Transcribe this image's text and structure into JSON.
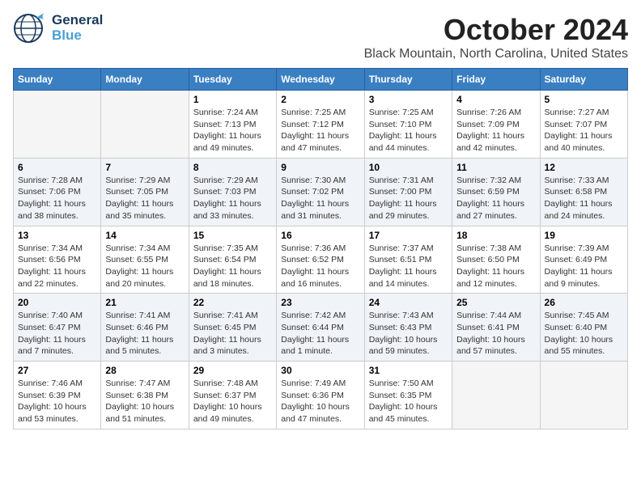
{
  "logo": {
    "line1": "General",
    "line2": "Blue",
    "tagline": ""
  },
  "title": "October 2024",
  "location": "Black Mountain, North Carolina, United States",
  "headers": [
    "Sunday",
    "Monday",
    "Tuesday",
    "Wednesday",
    "Thursday",
    "Friday",
    "Saturday"
  ],
  "weeks": [
    [
      {
        "day": "",
        "info": ""
      },
      {
        "day": "",
        "info": ""
      },
      {
        "day": "1",
        "info": "Sunrise: 7:24 AM\nSunset: 7:13 PM\nDaylight: 11 hours and 49 minutes."
      },
      {
        "day": "2",
        "info": "Sunrise: 7:25 AM\nSunset: 7:12 PM\nDaylight: 11 hours and 47 minutes."
      },
      {
        "day": "3",
        "info": "Sunrise: 7:25 AM\nSunset: 7:10 PM\nDaylight: 11 hours and 44 minutes."
      },
      {
        "day": "4",
        "info": "Sunrise: 7:26 AM\nSunset: 7:09 PM\nDaylight: 11 hours and 42 minutes."
      },
      {
        "day": "5",
        "info": "Sunrise: 7:27 AM\nSunset: 7:07 PM\nDaylight: 11 hours and 40 minutes."
      }
    ],
    [
      {
        "day": "6",
        "info": "Sunrise: 7:28 AM\nSunset: 7:06 PM\nDaylight: 11 hours and 38 minutes."
      },
      {
        "day": "7",
        "info": "Sunrise: 7:29 AM\nSunset: 7:05 PM\nDaylight: 11 hours and 35 minutes."
      },
      {
        "day": "8",
        "info": "Sunrise: 7:29 AM\nSunset: 7:03 PM\nDaylight: 11 hours and 33 minutes."
      },
      {
        "day": "9",
        "info": "Sunrise: 7:30 AM\nSunset: 7:02 PM\nDaylight: 11 hours and 31 minutes."
      },
      {
        "day": "10",
        "info": "Sunrise: 7:31 AM\nSunset: 7:00 PM\nDaylight: 11 hours and 29 minutes."
      },
      {
        "day": "11",
        "info": "Sunrise: 7:32 AM\nSunset: 6:59 PM\nDaylight: 11 hours and 27 minutes."
      },
      {
        "day": "12",
        "info": "Sunrise: 7:33 AM\nSunset: 6:58 PM\nDaylight: 11 hours and 24 minutes."
      }
    ],
    [
      {
        "day": "13",
        "info": "Sunrise: 7:34 AM\nSunset: 6:56 PM\nDaylight: 11 hours and 22 minutes."
      },
      {
        "day": "14",
        "info": "Sunrise: 7:34 AM\nSunset: 6:55 PM\nDaylight: 11 hours and 20 minutes."
      },
      {
        "day": "15",
        "info": "Sunrise: 7:35 AM\nSunset: 6:54 PM\nDaylight: 11 hours and 18 minutes."
      },
      {
        "day": "16",
        "info": "Sunrise: 7:36 AM\nSunset: 6:52 PM\nDaylight: 11 hours and 16 minutes."
      },
      {
        "day": "17",
        "info": "Sunrise: 7:37 AM\nSunset: 6:51 PM\nDaylight: 11 hours and 14 minutes."
      },
      {
        "day": "18",
        "info": "Sunrise: 7:38 AM\nSunset: 6:50 PM\nDaylight: 11 hours and 12 minutes."
      },
      {
        "day": "19",
        "info": "Sunrise: 7:39 AM\nSunset: 6:49 PM\nDaylight: 11 hours and 9 minutes."
      }
    ],
    [
      {
        "day": "20",
        "info": "Sunrise: 7:40 AM\nSunset: 6:47 PM\nDaylight: 11 hours and 7 minutes."
      },
      {
        "day": "21",
        "info": "Sunrise: 7:41 AM\nSunset: 6:46 PM\nDaylight: 11 hours and 5 minutes."
      },
      {
        "day": "22",
        "info": "Sunrise: 7:41 AM\nSunset: 6:45 PM\nDaylight: 11 hours and 3 minutes."
      },
      {
        "day": "23",
        "info": "Sunrise: 7:42 AM\nSunset: 6:44 PM\nDaylight: 11 hours and 1 minute."
      },
      {
        "day": "24",
        "info": "Sunrise: 7:43 AM\nSunset: 6:43 PM\nDaylight: 10 hours and 59 minutes."
      },
      {
        "day": "25",
        "info": "Sunrise: 7:44 AM\nSunset: 6:41 PM\nDaylight: 10 hours and 57 minutes."
      },
      {
        "day": "26",
        "info": "Sunrise: 7:45 AM\nSunset: 6:40 PM\nDaylight: 10 hours and 55 minutes."
      }
    ],
    [
      {
        "day": "27",
        "info": "Sunrise: 7:46 AM\nSunset: 6:39 PM\nDaylight: 10 hours and 53 minutes."
      },
      {
        "day": "28",
        "info": "Sunrise: 7:47 AM\nSunset: 6:38 PM\nDaylight: 10 hours and 51 minutes."
      },
      {
        "day": "29",
        "info": "Sunrise: 7:48 AM\nSunset: 6:37 PM\nDaylight: 10 hours and 49 minutes."
      },
      {
        "day": "30",
        "info": "Sunrise: 7:49 AM\nSunset: 6:36 PM\nDaylight: 10 hours and 47 minutes."
      },
      {
        "day": "31",
        "info": "Sunrise: 7:50 AM\nSunset: 6:35 PM\nDaylight: 10 hours and 45 minutes."
      },
      {
        "day": "",
        "info": ""
      },
      {
        "day": "",
        "info": ""
      }
    ]
  ]
}
